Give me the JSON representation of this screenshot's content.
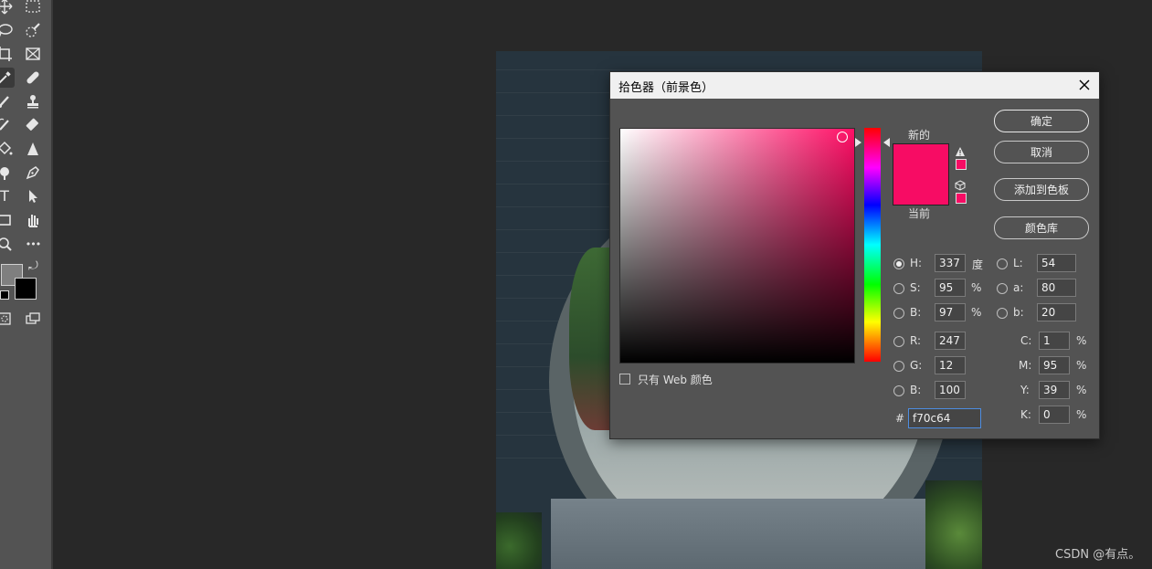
{
  "dialog": {
    "title": "拾色器（前景色）",
    "label_new": "新的",
    "label_current": "当前",
    "new_color": "#f70c64",
    "current_color": "#f70c64",
    "buttons": {
      "ok": "确定",
      "cancel": "取消",
      "add_to_swatches": "添加到色板",
      "color_libraries": "颜色库"
    },
    "web_only_label": "只有 Web 颜色",
    "fields": {
      "H": {
        "label": "H:",
        "value": "337",
        "unit": "度"
      },
      "S": {
        "label": "S:",
        "value": "95",
        "unit": "%"
      },
      "Bv": {
        "label": "B:",
        "value": "97",
        "unit": "%"
      },
      "R": {
        "label": "R:",
        "value": "247"
      },
      "G": {
        "label": "G:",
        "value": "12"
      },
      "Bc": {
        "label": "B:",
        "value": "100"
      },
      "L": {
        "label": "L:",
        "value": "54"
      },
      "a": {
        "label": "a:",
        "value": "80"
      },
      "b": {
        "label": "b:",
        "value": "20"
      },
      "C": {
        "label": "C:",
        "value": "1",
        "unit": "%"
      },
      "M": {
        "label": "M:",
        "value": "95",
        "unit": "%"
      },
      "Y": {
        "label": "Y:",
        "value": "39",
        "unit": "%"
      },
      "K": {
        "label": "K:",
        "value": "0",
        "unit": "%"
      }
    },
    "hex_label": "#",
    "hex_value": "f70c64",
    "selected_mode": "H"
  },
  "toolbar": {
    "icons": [
      "move-icon",
      "marquee-icon",
      "lasso-icon",
      "quick-select-icon",
      "crop-icon",
      "frame-icon",
      "eyedropper-icon",
      "healing-brush-icon",
      "brush-icon",
      "stamp-icon",
      "history-brush-icon",
      "eraser-icon",
      "paint-bucket-icon",
      "sharpen-icon",
      "dodge-icon",
      "pen-icon",
      "type-icon",
      "path-select-icon",
      "rectangle-icon",
      "hand-icon",
      "zoom-icon",
      "more-icon"
    ],
    "type_glyph": "T",
    "more_glyph": "•••",
    "foreground_color": "#7f7f7f",
    "background_color": "#000000"
  },
  "watermark": "CSDN @有点。"
}
